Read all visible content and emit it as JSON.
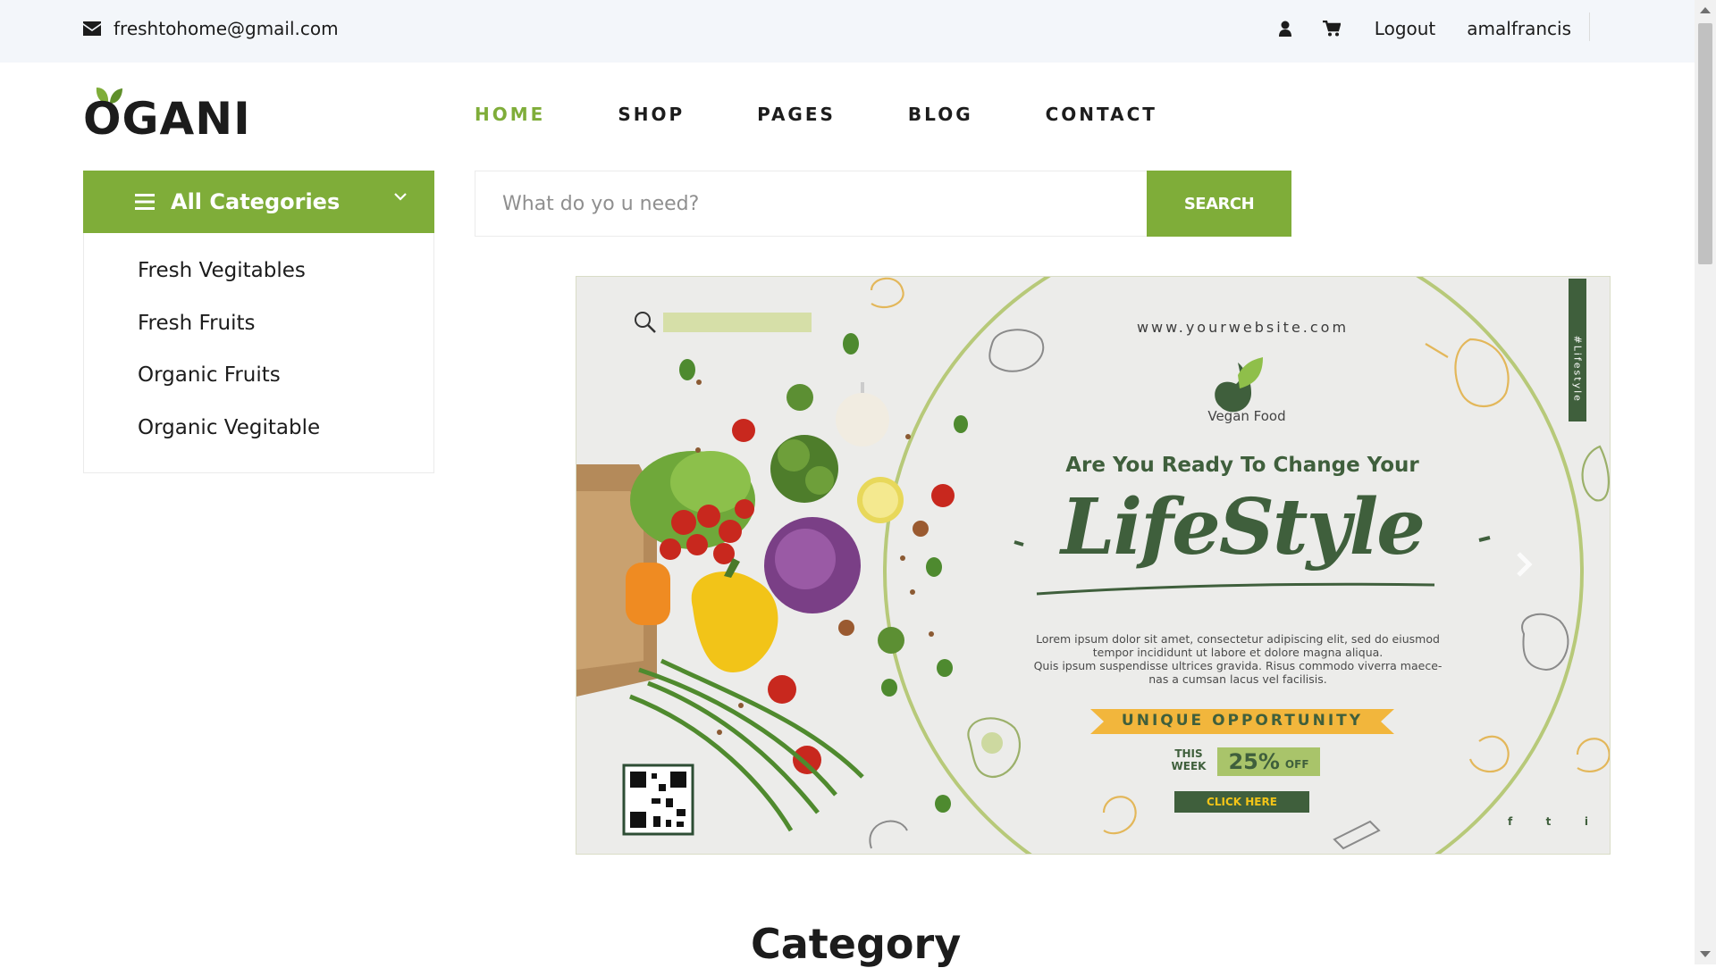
{
  "topbar": {
    "email": "freshtohome@gmail.com",
    "logout": "Logout",
    "username": "amalfrancis"
  },
  "logo": {
    "text": "OGANI"
  },
  "nav": {
    "items": [
      "HOME",
      "SHOP",
      "PAGES",
      "BLOG",
      "CONTACT"
    ],
    "active": "HOME"
  },
  "categories": {
    "title": "All Categories",
    "items": [
      "Fresh Vegitables",
      "Fresh Fruits",
      "Organic Fruits",
      "Organic Vegitable"
    ]
  },
  "search": {
    "placeholder": "What do yo u need?",
    "button_label": "SEARCH"
  },
  "banner": {
    "website": "www.yourwebsite.com",
    "brand": "Vegan Food",
    "side_tag": "#Lifestyle",
    "headline": "Are You Ready To Change Your",
    "script": "LifeStyle",
    "body_lines": [
      "Lorem ipsum dolor sit amet, consectetur adipiscing elit, sed do eiusmod",
      "tempor incididunt ut labore et dolore magna aliqua.",
      "Quis ipsum suspendisse ultrices gravida. Risus commodo viverra maece-",
      "nas a cumsan lacus vel  facilisis."
    ],
    "ribbon": "UNIQUE OPPORTUNITY",
    "this_week": [
      "THIS",
      "WEEK"
    ],
    "discount": "25%",
    "off": "OFF",
    "cta": "CLICK HERE",
    "social": [
      "f",
      "t",
      "i"
    ]
  },
  "section": {
    "title": "Category"
  },
  "colors": {
    "accent": "#7fad39",
    "banner_green": "#3f5f3c",
    "ribbon_yellow": "#f2b63c"
  },
  "icons": [
    "envelope-icon",
    "user-icon",
    "cart-icon",
    "menu-bars-icon",
    "chevron-down-icon",
    "search-icon",
    "chevron-right-icon",
    "qr-code-icon"
  ]
}
